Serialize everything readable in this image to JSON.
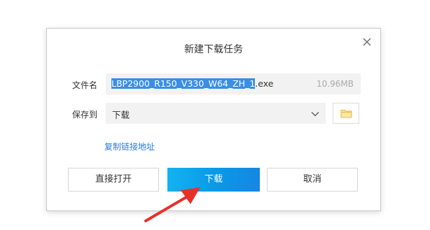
{
  "dialog": {
    "title": "新建下载任务",
    "close_icon": "close-icon"
  },
  "filename": {
    "label": "文件名",
    "selected_text": "LBP2900_R150_V330_W64_ZH_1",
    "extension": ".exe",
    "size": "10.96MB"
  },
  "save_to": {
    "label": "保存到",
    "value": "下载",
    "dropdown_icon": "chevron-down-icon",
    "browse_icon": "folder-icon"
  },
  "copy_link_label": "复制链接地址",
  "buttons": {
    "open": "直接打开",
    "download": "下载",
    "cancel": "取消"
  },
  "colors": {
    "accent": "#0a9ae8",
    "link": "#2a7ce0",
    "selection": "#3a8ee6",
    "annotation_arrow": "#e8302a"
  }
}
